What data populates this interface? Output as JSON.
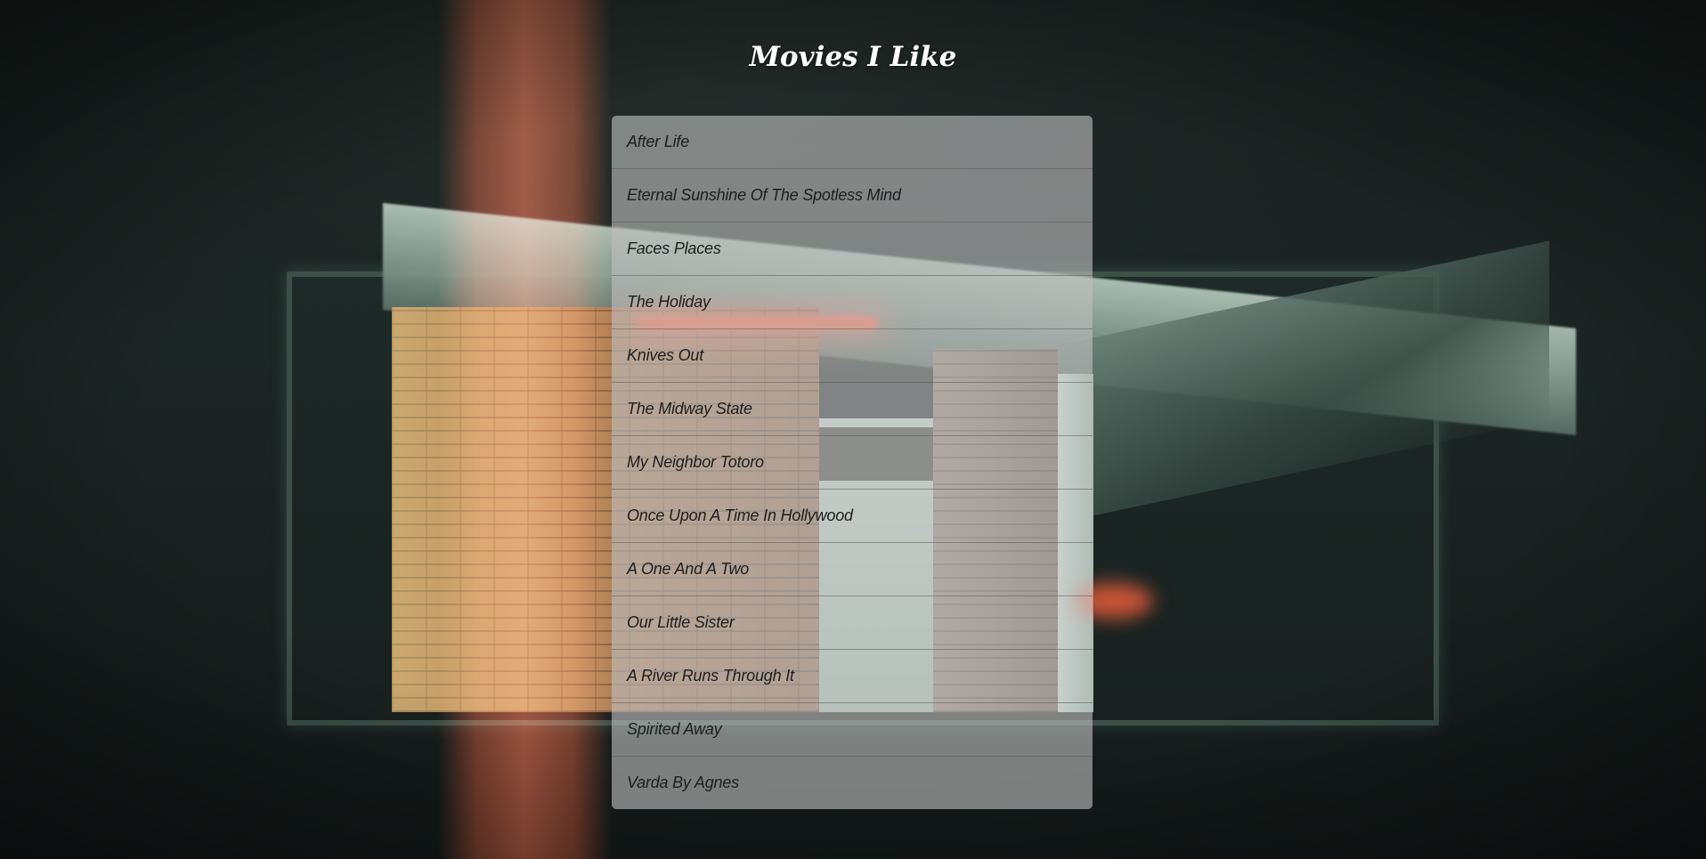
{
  "page": {
    "title": "Movies I Like"
  },
  "movies": [
    {
      "title": "After Life"
    },
    {
      "title": "Eternal Sunshine Of The Spotless Mind"
    },
    {
      "title": "Faces Places"
    },
    {
      "title": "The Holiday"
    },
    {
      "title": "Knives Out"
    },
    {
      "title": "The Midway State"
    },
    {
      "title": "My Neighbor Totoro"
    },
    {
      "title": "Once Upon A Time In Hollywood"
    },
    {
      "title": "A One And A Two"
    },
    {
      "title": "Our Little Sister"
    },
    {
      "title": "A River Runs Through It"
    },
    {
      "title": "Spirited Away"
    },
    {
      "title": "Varda By Agnes"
    }
  ],
  "colors": {
    "title_text": "#ffffff",
    "list_panel": "#bebebe",
    "item_text": "#1e1e1e"
  }
}
